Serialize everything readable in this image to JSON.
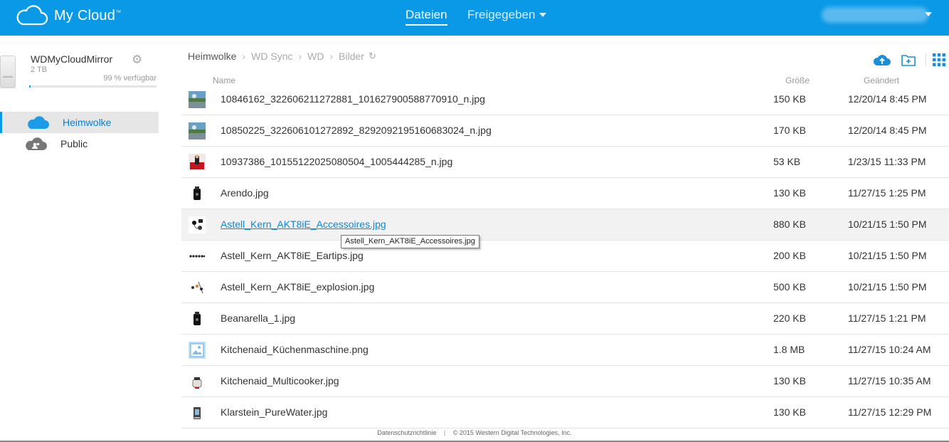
{
  "header": {
    "logo_text": "My Cloud",
    "trademark": "™",
    "nav_files": "Dateien",
    "nav_shared": "Freigegeben"
  },
  "device": {
    "name": "WDMyCloudMirror",
    "capacity": "2 TB",
    "free_text": "99 % verfügbar",
    "usage_fraction": 0.01
  },
  "sidebar": {
    "items": [
      {
        "label": "Heimwolke",
        "active": true
      },
      {
        "label": "Public",
        "active": false
      }
    ]
  },
  "breadcrumb": [
    "Heimwolke",
    "WD Sync",
    "WD",
    "Bilder"
  ],
  "columns": {
    "name": "Name",
    "size": "Größe",
    "modified": "Geändert"
  },
  "files": [
    {
      "name": "10846162_322606211272881_101627900588770910_n.jpg",
      "size": "150 KB",
      "date": "12/20/14 8:45 PM",
      "thumb": "photo-landscape"
    },
    {
      "name": "10850225_322606101272892_8292092195160683024_n.jpg",
      "size": "170 KB",
      "date": "12/20/14 8:45 PM",
      "thumb": "photo-landscape"
    },
    {
      "name": "10937386_10155122025080504_1005444285_n.jpg",
      "size": "53 KB",
      "date": "1/23/15 11:33 PM",
      "thumb": "photo-red"
    },
    {
      "name": "Arendo.jpg",
      "size": "130 KB",
      "date": "11/27/15 1:25 PM",
      "thumb": "product-black"
    },
    {
      "name": "Astell_Kern_AKT8iE_Accessoires.jpg",
      "size": "880 KB",
      "date": "10/21/15 1:50 PM",
      "thumb": "product-earphones"
    },
    {
      "name": "Astell_Kern_AKT8iE_Eartips.jpg",
      "size": "200 KB",
      "date": "10/21/15 1:50 PM",
      "thumb": "product-eartips"
    },
    {
      "name": "Astell_Kern_AKT8iE_explosion.jpg",
      "size": "500 KB",
      "date": "10/21/15 1:50 PM",
      "thumb": "product-explosion"
    },
    {
      "name": "Beanarella_1.jpg",
      "size": "220 KB",
      "date": "11/27/15 1:21 PM",
      "thumb": "product-black"
    },
    {
      "name": "Kitchenaid_Küchenmaschine.png",
      "size": "1.8 MB",
      "date": "11/27/15 10:24 AM",
      "thumb": "image-placeholder"
    },
    {
      "name": "Kitchenaid_Multicooker.jpg",
      "size": "130 KB",
      "date": "11/27/15 10:35 AM",
      "thumb": "product-cooker"
    },
    {
      "name": "Klarstein_PureWater.jpg",
      "size": "130 KB",
      "date": "11/27/15 12:29 PM",
      "thumb": "product-water"
    }
  ],
  "tooltip": "Astell_Kern_AKT8iE_Accessoires.jpg",
  "footer": {
    "privacy": "Datenschutzrichtlinie",
    "copyright": "© 2015 Western Digital Technologies, Inc."
  },
  "colors": {
    "brand": "#0a99e6",
    "link": "#0a87d6"
  }
}
